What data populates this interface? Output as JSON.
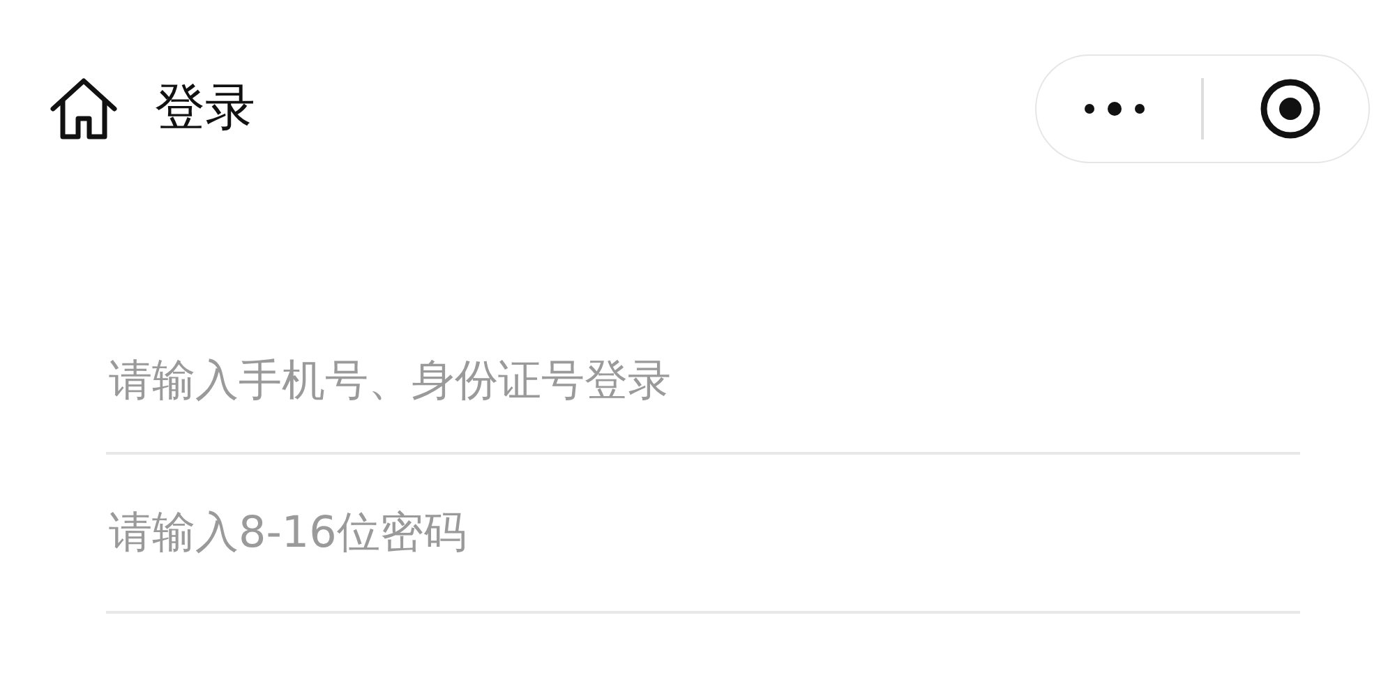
{
  "nav_bar": {
    "title": "登录"
  },
  "fields": [
    {
      "placeholder": "请输入手机号、身份证号登录"
    },
    {
      "placeholder": "请输入8-16位密码"
    }
  ]
}
